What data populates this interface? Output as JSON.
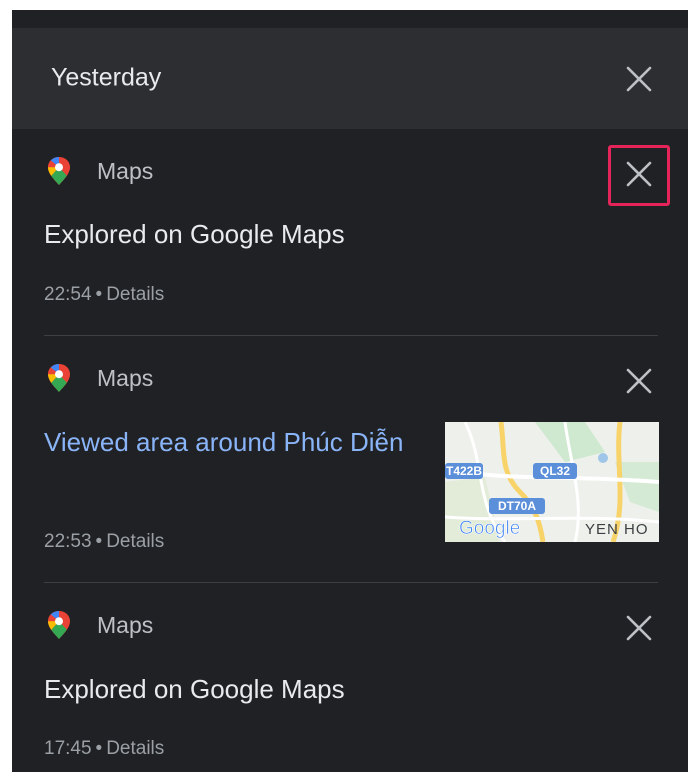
{
  "header": {
    "title": "Yesterday"
  },
  "entries": [
    {
      "app": "Maps",
      "title": "Explored on Google Maps",
      "time": "22:54",
      "details": "Details"
    },
    {
      "app": "Maps",
      "title": "Viewed area around Phúc Diễn",
      "time": "22:53",
      "details": "Details",
      "map_labels": [
        "T422B",
        "QL32",
        "DT70A",
        "YEN HO"
      ],
      "map_logo": "Google"
    },
    {
      "app": "Maps",
      "title": "Explored on Google Maps",
      "time": "17:45",
      "details": "Details"
    }
  ],
  "icons": {
    "close": "close-icon",
    "app": "google-maps-pin-icon"
  },
  "colors": {
    "highlight": "#e5245a",
    "link": "#8ab4f8",
    "background": "#202124",
    "header": "#2d2e31"
  }
}
